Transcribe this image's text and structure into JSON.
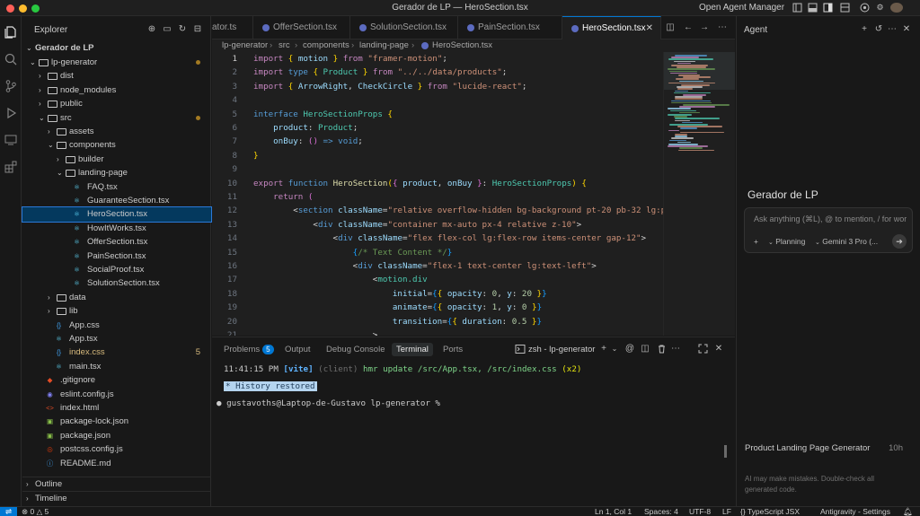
{
  "window": {
    "title": "Gerador de LP — HeroSection.tsx",
    "agent_manager": "Open Agent Manager"
  },
  "explorer": {
    "title": "Explorer",
    "root": "Gerador de LP",
    "tree": [
      {
        "label": "lp-generator",
        "kind": "folder-open",
        "depth": 1,
        "dot": true
      },
      {
        "label": "dist",
        "kind": "folder",
        "depth": 2
      },
      {
        "label": "node_modules",
        "kind": "folder",
        "depth": 2
      },
      {
        "label": "public",
        "kind": "folder",
        "depth": 2
      },
      {
        "label": "src",
        "kind": "folder-open",
        "depth": 2,
        "dot": true
      },
      {
        "label": "assets",
        "kind": "folder",
        "depth": 3
      },
      {
        "label": "components",
        "kind": "folder-open",
        "depth": 3
      },
      {
        "label": "builder",
        "kind": "folder",
        "depth": 4
      },
      {
        "label": "landing-page",
        "kind": "folder-open",
        "depth": 4
      },
      {
        "label": "FAQ.tsx",
        "kind": "react",
        "depth": 5
      },
      {
        "label": "GuaranteeSection.tsx",
        "kind": "react",
        "depth": 5
      },
      {
        "label": "HeroSection.tsx",
        "kind": "react",
        "depth": 5,
        "selected": true
      },
      {
        "label": "HowItWorks.tsx",
        "kind": "react",
        "depth": 5
      },
      {
        "label": "OfferSection.tsx",
        "kind": "react",
        "depth": 5
      },
      {
        "label": "PainSection.tsx",
        "kind": "react",
        "depth": 5
      },
      {
        "label": "SocialProof.tsx",
        "kind": "react",
        "depth": 5
      },
      {
        "label": "SolutionSection.tsx",
        "kind": "react",
        "depth": 5
      },
      {
        "label": "data",
        "kind": "folder",
        "depth": 3
      },
      {
        "label": "lib",
        "kind": "folder",
        "depth": 3
      },
      {
        "label": "App.css",
        "kind": "css",
        "depth": 3
      },
      {
        "label": "App.tsx",
        "kind": "react",
        "depth": 3
      },
      {
        "label": "index.css",
        "kind": "css",
        "depth": 3,
        "modified": "5"
      },
      {
        "label": "main.tsx",
        "kind": "react",
        "depth": 3
      },
      {
        "label": ".gitignore",
        "kind": "git",
        "depth": 2
      },
      {
        "label": "eslint.config.js",
        "kind": "eslint",
        "depth": 2
      },
      {
        "label": "index.html",
        "kind": "html",
        "depth": 2
      },
      {
        "label": "package-lock.json",
        "kind": "npm",
        "depth": 2
      },
      {
        "label": "package.json",
        "kind": "npm",
        "depth": 2
      },
      {
        "label": "postcss.config.js",
        "kind": "postcss",
        "depth": 2
      },
      {
        "label": "README.md",
        "kind": "info",
        "depth": 2
      }
    ],
    "outline": "Outline",
    "timeline": "Timeline"
  },
  "tabs": [
    {
      "label": "ator.ts",
      "active": false
    },
    {
      "label": "OfferSection.tsx",
      "active": false
    },
    {
      "label": "SolutionSection.tsx",
      "active": false
    },
    {
      "label": "PainSection.tsx",
      "active": false
    },
    {
      "label": "HeroSection.tsx",
      "active": true
    }
  ],
  "breadcrumb": [
    "lp-generator",
    "src",
    "components",
    "landing-page",
    "HeroSection.tsx"
  ],
  "panel": {
    "tabs": [
      "Problems",
      "Output",
      "Debug Console",
      "Terminal",
      "Ports"
    ],
    "problems_count": "5",
    "active_tab": "Terminal",
    "terminal_name": "zsh - lp-generator",
    "log_time": "11:41:15 PM",
    "log_tag": "[vite]",
    "log_client": "(client)",
    "log_msg": "hmr update /src/App.tsx, /src/index.css",
    "log_count": "(x2)",
    "history": "* History restored",
    "prompt": "gustavoths@Laptop-de-Gustavo lp-generator %"
  },
  "agent": {
    "title": "Agent",
    "heading": "Gerador de LP",
    "input_placeholder": "Ask anything (⌘L), @ to mention, / for wor",
    "mode": "Planning",
    "model": "Gemini 3 Pro (...",
    "conversation_title": "Product Landing Page Generator",
    "conversation_age": "10h",
    "disclaimer": "AI may make mistakes. Double-check all generated code."
  },
  "status": {
    "errors": "0",
    "warnings": "5",
    "position": "Ln 1, Col 1",
    "spaces": "Spaces: 4",
    "encoding": "UTF-8",
    "eol": "LF",
    "language": "TypeScript JSX",
    "settings": "Antigravity - Settings"
  }
}
